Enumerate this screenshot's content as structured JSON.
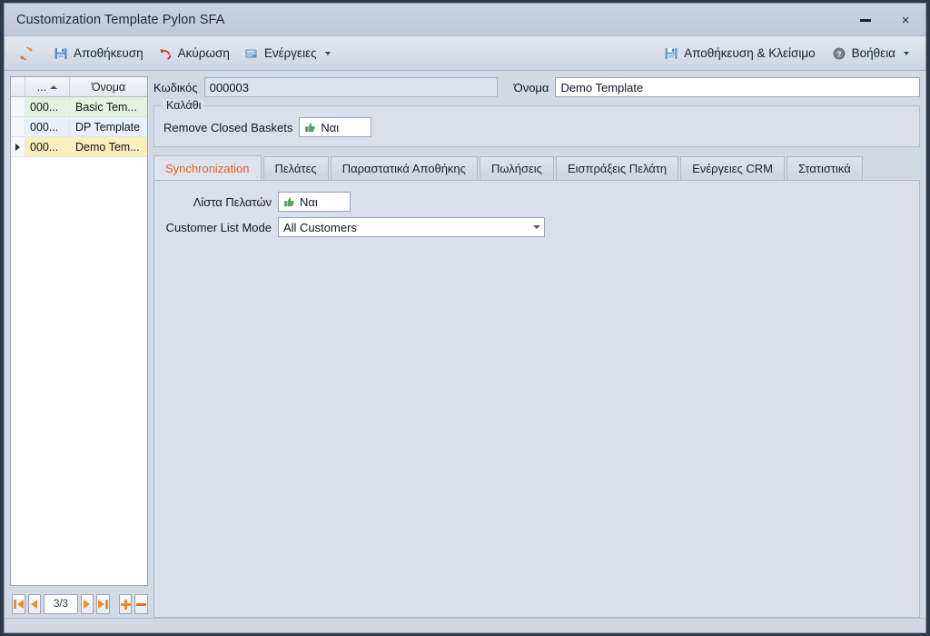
{
  "window": {
    "title": "Customization Template Pylon SFA",
    "minimize_label": "Minimize",
    "close_label": "×"
  },
  "toolbar": {
    "refresh_label": "",
    "save_label": "Αποθήκευση",
    "cancel_label": "Ακύρωση",
    "actions_label": "Ενέργειες",
    "save_close_label": "Αποθήκευση & Κλείσιμο",
    "help_label": "Βοήθεια"
  },
  "grid": {
    "columns": [
      "...",
      "Όνομα"
    ],
    "rows": [
      {
        "code": "000...",
        "name": "Basic Tem..."
      },
      {
        "code": "000...",
        "name": "DP Template"
      },
      {
        "code": "000...",
        "name": "Demo Tem..."
      }
    ]
  },
  "navigation": {
    "position": "3/3",
    "first_label": "First",
    "prev_label": "Previous",
    "next_label": "Next",
    "last_label": "Last",
    "add_label": "Add",
    "remove_label": "Remove"
  },
  "header_fields": {
    "code_label": "Κωδικός",
    "code_value": "000003",
    "name_label": "Όνομα",
    "name_value": "Demo Template"
  },
  "basket_group": {
    "title": "Καλάθι",
    "remove_closed_label": "Remove Closed Baskets",
    "remove_closed_value": "Ναι"
  },
  "tabs": [
    {
      "label": "Synchronization",
      "active": true
    },
    {
      "label": "Πελάτες",
      "active": false
    },
    {
      "label": "Παραστατικά Αποθήκης",
      "active": false
    },
    {
      "label": "Πωλήσεις",
      "active": false
    },
    {
      "label": "Εισπράξεις Πελάτη",
      "active": false
    },
    {
      "label": "Ενέργειες CRM",
      "active": false
    },
    {
      "label": "Στατιστικά",
      "active": false
    }
  ],
  "sync_panel": {
    "customer_list_label": "Λίστα Πελατών",
    "customer_list_value": "Ναι",
    "customer_list_mode_label": "Customer List Mode",
    "customer_list_mode_value": "All Customers"
  },
  "colors": {
    "accent_orange": "#e2622a",
    "icon_orange": "#ef8c2a",
    "window_bg": "#d4d9e6",
    "selected_row": "#fbeebd"
  }
}
